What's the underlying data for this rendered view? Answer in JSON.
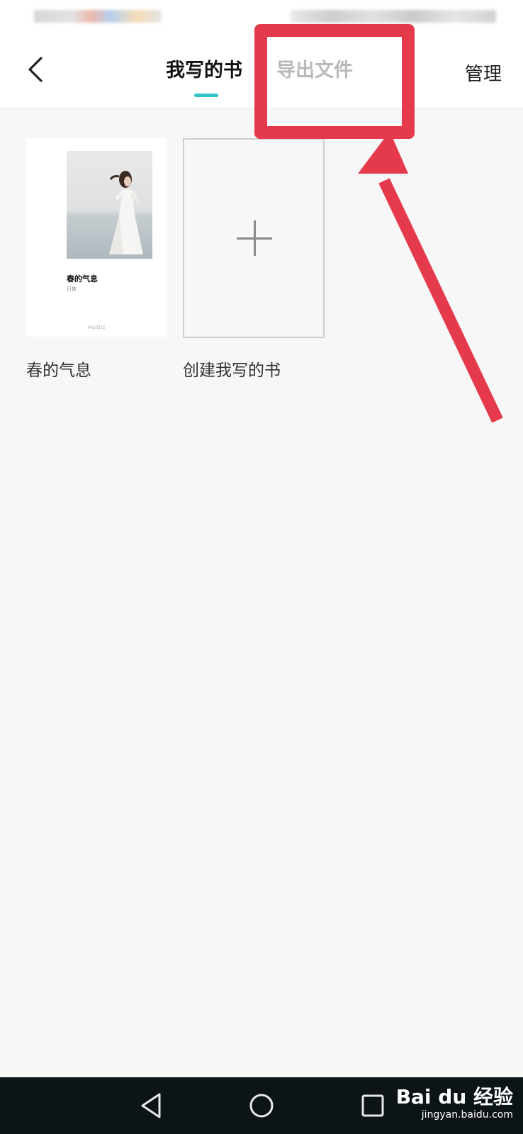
{
  "header": {
    "back_icon": "chevron-left-icon",
    "tabs": [
      {
        "label": "我写的书",
        "active": true
      },
      {
        "label": "导出文件",
        "active": false
      }
    ],
    "manage_label": "管理",
    "indicator_color": "#2fc3c8"
  },
  "books": [
    {
      "caption": "春的气息",
      "cover_title": "春的气息",
      "cover_author": "日抹",
      "cover_footer": "Moji日记"
    }
  ],
  "create_card": {
    "caption": "创建我写的书",
    "icon": "plus-icon"
  },
  "annotation": {
    "color": "#e43a4b",
    "target": "导出文件"
  },
  "navbar": {
    "buttons": [
      "back-triangle-icon",
      "home-circle-icon",
      "recents-square-icon"
    ]
  },
  "watermark": {
    "logo": "Bai du 经验",
    "url": "jingyan.baidu.com"
  }
}
